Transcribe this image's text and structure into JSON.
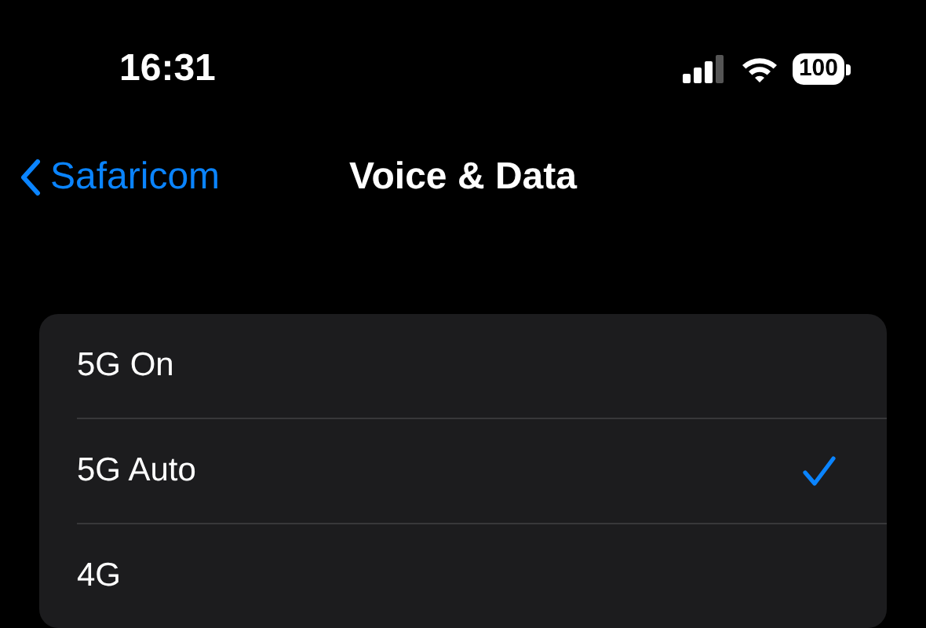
{
  "status_bar": {
    "time": "16:31",
    "battery": "100"
  },
  "nav": {
    "back": "Safaricom",
    "title": "Voice & Data"
  },
  "options": [
    {
      "label": "5G On",
      "selected": false
    },
    {
      "label": "5G Auto",
      "selected": true
    },
    {
      "label": "4G",
      "selected": false
    }
  ]
}
